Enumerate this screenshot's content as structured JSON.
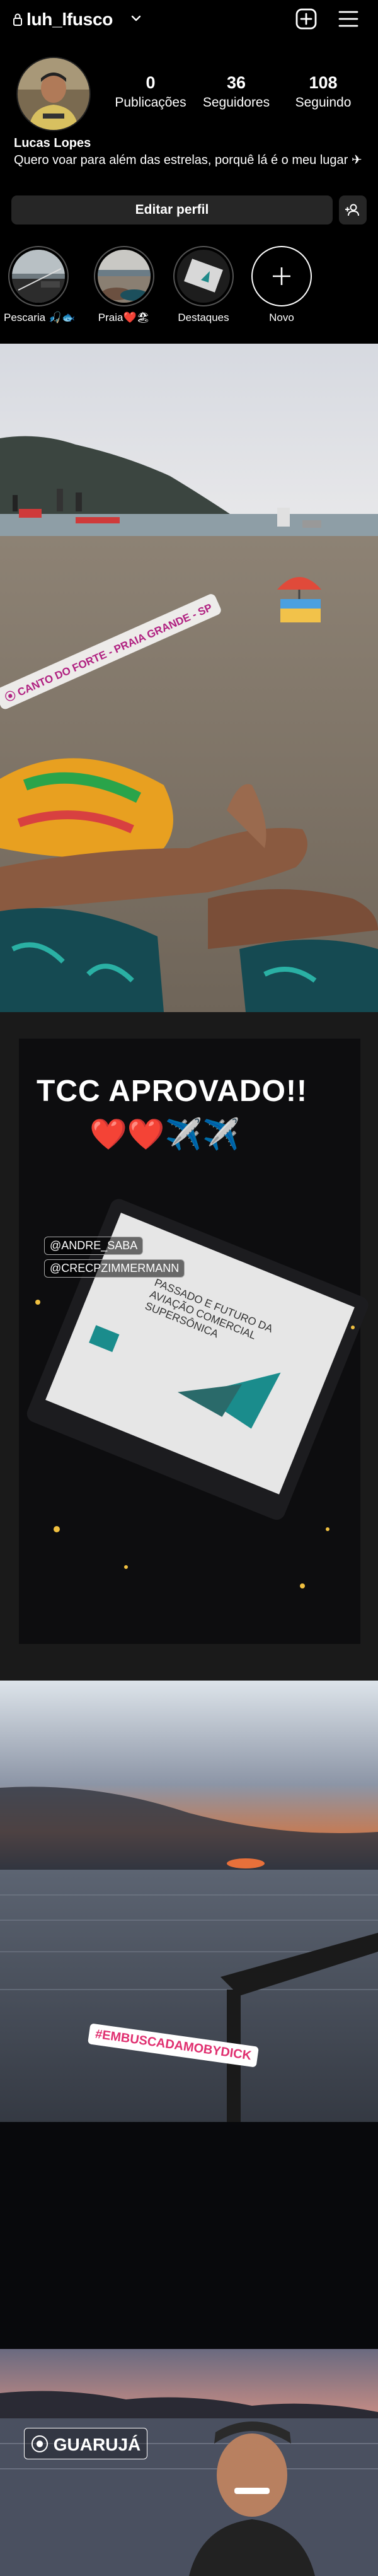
{
  "header": {
    "username": "luh_lfusco"
  },
  "profile": {
    "stats": [
      {
        "value": "0",
        "label": "Publicações"
      },
      {
        "value": "36",
        "label": "Seguidores"
      },
      {
        "value": "108",
        "label": "Seguindo"
      }
    ],
    "full_name": "Lucas Lopes",
    "bio": "Quero voar para além das estrelas, porquê lá é o meu lugar ✈"
  },
  "actions": {
    "edit_profile": "Editar perfil"
  },
  "highlights": [
    {
      "label": "Pescaria 🎣🐟"
    },
    {
      "label": "Praia❤️🏖"
    },
    {
      "label": "Destaques"
    },
    {
      "label": "Novo"
    }
  ],
  "feed": {
    "post1": {
      "location_sticker": "CANTO DO FORTE - PRAIA GRANDE - SP"
    },
    "post2": {
      "headline": "TCC APROVADO!!",
      "emoji_line": "❤️❤️✈️✈️",
      "slide_title": "PASSADO E FUTURO DA AVIAÇÃO COMERCIAL SUPERSÔNICA",
      "mention_1": "@ANDRE_SABA",
      "mention_2": "@CRECPZIMMERMANN"
    },
    "post3": {
      "hashtag": "#EMBUSCADAMOBYDICK"
    },
    "post4": {
      "location_sticker": "GUARUJÁ"
    }
  }
}
